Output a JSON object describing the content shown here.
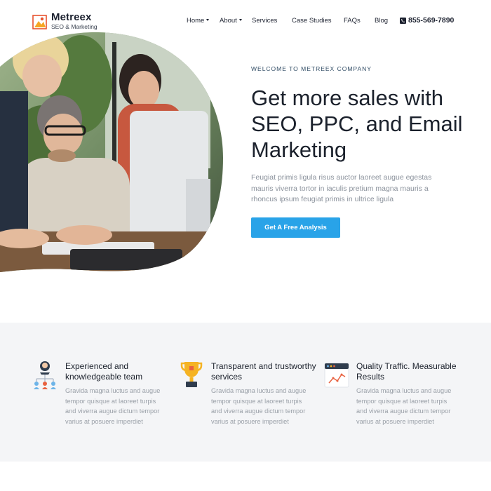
{
  "brand": {
    "name": "Metreex",
    "tagline": "SEO & Marketing",
    "accent_color": "#29a3e8",
    "logo_colors": [
      "#f5a623",
      "#e8532f"
    ]
  },
  "nav": {
    "items": [
      {
        "label": "Home",
        "has_dropdown": true
      },
      {
        "label": "About",
        "has_dropdown": true
      },
      {
        "label": "Services",
        "has_dropdown": false
      },
      {
        "label": "Case Studies",
        "has_dropdown": false
      },
      {
        "label": "FAQs",
        "has_dropdown": false
      },
      {
        "label": "Blog",
        "has_dropdown": false
      }
    ],
    "phone": "855-569-7890",
    "phone_icon": "phone-icon"
  },
  "hero": {
    "eyebrow": "WELCOME TO METREEX COMPANY",
    "title": "Get more sales with SEO, PPC, and Email Marketing",
    "description": "Feugiat primis ligula risus auctor laoreet augue egestas mauris viverra tortor in iaculis pretium magna mauris a rhoncus ipsum feugiat primis in ultrice ligula",
    "cta_label": "Get A Free Analysis"
  },
  "features": [
    {
      "icon": "team-icon",
      "title": "Experienced and knowledgeable team",
      "description": "Gravida magna luctus and augue tempor quisque at laoreet turpis and viverra augue dictum tempor varius at posuere imperdiet"
    },
    {
      "icon": "trophy-icon",
      "title": "Transparent and trustworthy services",
      "description": "Gravida magna luctus and augue tempor quisque at laoreet turpis and viverra augue dictum tempor varius at posuere imperdiet"
    },
    {
      "icon": "analytics-chart-icon",
      "title": "Quality Traffic. Measurable Results",
      "description": "Gravida magna luctus and augue tempor quisque at laoreet turpis and viverra augue dictum tempor varius at posuere imperdiet"
    }
  ]
}
